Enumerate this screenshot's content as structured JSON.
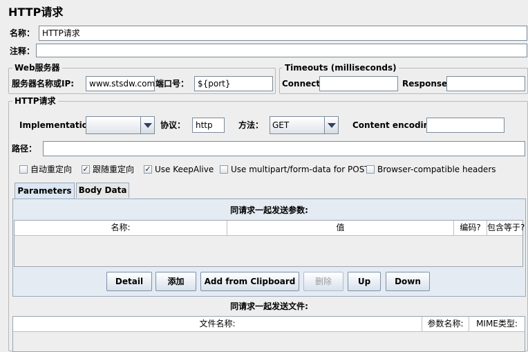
{
  "title": "HTTP请求",
  "name": {
    "label": "名称：",
    "value": "HTTP请求"
  },
  "comment": {
    "label": "注释：",
    "value": ""
  },
  "web_server": {
    "title": "Web服务器",
    "host_label": "服务器名称或IP:",
    "host_value": "www.stsdw.com",
    "port_label": "端口号：",
    "port_value": "${port}"
  },
  "timeouts": {
    "title": "Timeouts (milliseconds)",
    "connect_label": "Connect:",
    "connect_value": "",
    "response_label": "Response:",
    "response_value": ""
  },
  "http_request": {
    "title": "HTTP请求",
    "implementation_label": "Implementation:",
    "implementation_value": "",
    "protocol_label": "协议：",
    "protocol_value": "http",
    "method_label": "方法：",
    "method_value": "GET",
    "encoding_label": "Content encoding:",
    "encoding_value": "",
    "path_label": "路径：",
    "path_value": ""
  },
  "options": [
    {
      "label": "自动重定向",
      "checked": false
    },
    {
      "label": "跟随重定向",
      "checked": true
    },
    {
      "label": "Use KeepAlive",
      "checked": true
    },
    {
      "label": "Use multipart/form-data for POST",
      "checked": false
    },
    {
      "label": "Browser-compatible headers",
      "checked": false
    }
  ],
  "tabs": [
    {
      "label": "Parameters",
      "active": true
    },
    {
      "label": "Body Data",
      "active": false
    }
  ],
  "params": {
    "title": "同请求一起发送参数:",
    "columns": [
      "名称:",
      "值",
      "编码?",
      "包含等于?"
    ]
  },
  "buttons": {
    "detail": "Detail",
    "add": "添加",
    "clipboard": "Add from Clipboard",
    "delete": "删除",
    "up": "Up",
    "down": "Down"
  },
  "files": {
    "title": "同请求一起发送文件:",
    "columns": [
      "文件名称:",
      "参数名称:",
      "MIME类型:"
    ]
  }
}
